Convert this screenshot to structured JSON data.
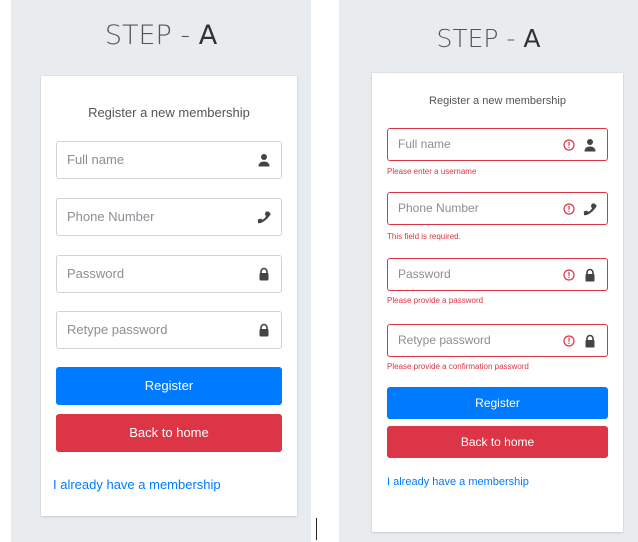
{
  "panel_a": {
    "step_prefix": "STEP - ",
    "step_letter": "A",
    "form_title": "Register a new membership",
    "fields": [
      {
        "placeholder": "Full name",
        "icon": "user-icon"
      },
      {
        "placeholder": "Phone Number",
        "icon": "phone-icon"
      },
      {
        "placeholder": "Password",
        "icon": "lock-icon"
      },
      {
        "placeholder": "Retype password",
        "icon": "lock-icon"
      }
    ],
    "register_label": "Register",
    "back_label": "Back to home",
    "membership_link": "I already have a membership"
  },
  "panel_b": {
    "step_prefix": "STEP - ",
    "step_letter": "A",
    "form_title": "Register a new membership",
    "fields": [
      {
        "placeholder": "Full name",
        "icon": "user-icon",
        "error": "Please enter a username"
      },
      {
        "placeholder": "Phone Number",
        "icon": "phone-icon",
        "error": "This field is required."
      },
      {
        "placeholder": "Password",
        "icon": "lock-icon",
        "error": "Please provide a password"
      },
      {
        "placeholder": "Retype password",
        "icon": "lock-icon",
        "error": "Please provide a confirmation password"
      }
    ],
    "register_label": "Register",
    "back_label": "Back to home",
    "membership_link": "I already have a membership"
  },
  "colors": {
    "primary": "#007bff",
    "danger": "#dc3545",
    "background": "#e9ecef"
  }
}
